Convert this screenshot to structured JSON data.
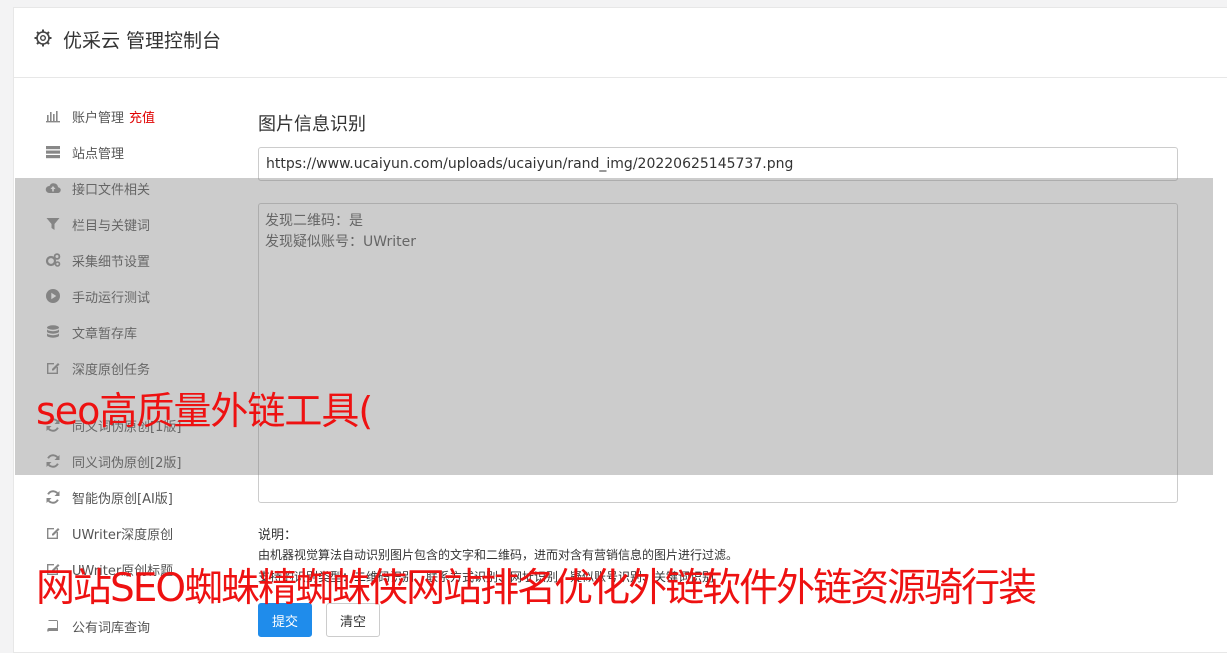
{
  "header": {
    "title": "优采云 管理控制台",
    "icon": "gear-icon"
  },
  "sidebar": {
    "items": [
      {
        "label": "账户管理",
        "extra": "充值",
        "icon": "bar-chart-icon"
      },
      {
        "label": "站点管理",
        "icon": "server-icon"
      },
      {
        "label": "接口文件相关",
        "icon": "cloud-upload-icon"
      },
      {
        "label": "栏目与关键词",
        "icon": "filter-icon"
      },
      {
        "label": "采集细节设置",
        "icon": "gears-icon"
      },
      {
        "label": "手动运行测试",
        "icon": "play-circle-icon"
      },
      {
        "label": "文章暂存库",
        "icon": "database-icon"
      },
      {
        "label": "深度原创任务",
        "icon": "edit-icon"
      },
      {
        "label": "同义词伪原创[1版]",
        "icon": "refresh-icon"
      },
      {
        "label": "同义词伪原创[2版]",
        "icon": "refresh-icon"
      },
      {
        "label": "智能伪原创[AI版]",
        "icon": "refresh-icon"
      },
      {
        "label": "UWriter深度原创",
        "icon": "edit-icon"
      },
      {
        "label": "UWriter原创标题",
        "icon": "edit-icon"
      },
      {
        "label": "公有词库查询",
        "icon": "book-icon"
      }
    ]
  },
  "main": {
    "title": "图片信息识别",
    "url_value": "https://www.ucaiyun.com/uploads/ucaiyun/rand_img/20220625145737.png",
    "result_lines": [
      "发现二维码：是",
      "发现疑似账号：UWriter"
    ],
    "note_label": "说明：",
    "note_text": "由机器视觉算法自动识别图片包含的文字和二维码，进而对含有营销信息的图片进行过滤。",
    "note_text2": "支持的识别类型：二维码识别、联系方式识别、网址识别、疑似账号识别、关键词识别",
    "submit_label": "提交",
    "clear_label": "清空"
  },
  "watermarks": {
    "line1": "seo高质量外链工具(",
    "line2": "网站SEO蜘蛛精蜘蛛侠网站排名优化外链软件外链资源骑行装"
  },
  "colors": {
    "accent": "#1f8ceb",
    "watermark": "#ee1111",
    "recharge": "#e00000"
  }
}
